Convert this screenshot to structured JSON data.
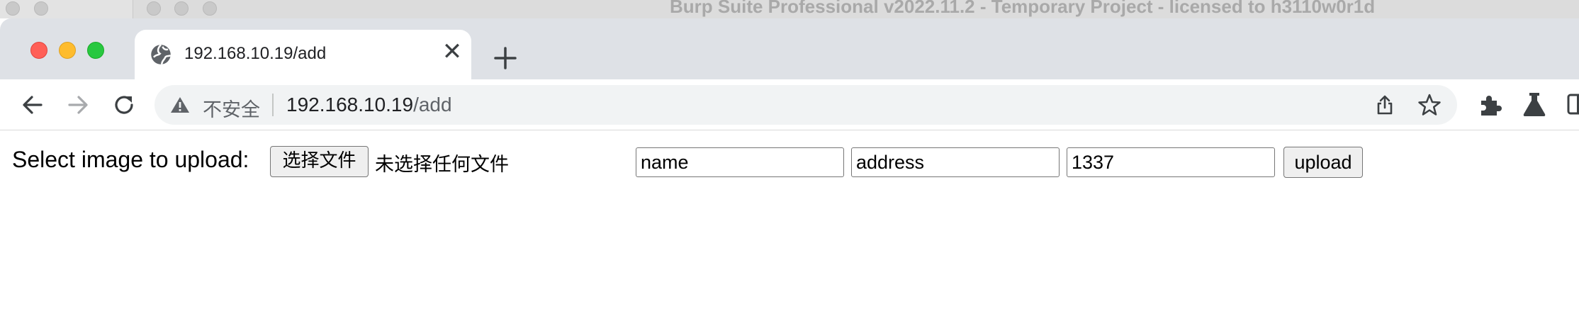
{
  "background_window": {
    "title": "Burp Suite Professional v2022.11.2 - Temporary Project - licensed to h3110w0r1d"
  },
  "browser": {
    "tab": {
      "title": "192.168.10.19/add",
      "favicon": "globe-icon",
      "close_glyph": "✕"
    },
    "new_tab_icon": "plus-icon",
    "toolbar": {
      "back_icon": "arrow-left-icon",
      "forward_icon": "arrow-right-icon",
      "reload_icon": "reload-icon"
    },
    "omnibox": {
      "security_icon": "warning-triangle-icon",
      "security_label": "不安全",
      "url_host": "192.168.10.19",
      "url_path": "/add",
      "share_icon": "share-icon",
      "bookmark_icon": "star-icon"
    },
    "extensions": [
      "puzzle-icon",
      "flask-icon",
      "side-panel-icon"
    ]
  },
  "page": {
    "upload_label": "Select image to upload:",
    "file_button_label": "选择文件",
    "file_status": "未选择任何文件",
    "fields": {
      "name": "name",
      "address": "address",
      "zip": "1337"
    },
    "submit_label": "upload"
  },
  "colors": {
    "tab_strip": "#dee1e6",
    "omnibox": "#f1f3f4",
    "close": "#ff5f57",
    "minimize": "#febc2e",
    "zoom": "#28c840"
  }
}
